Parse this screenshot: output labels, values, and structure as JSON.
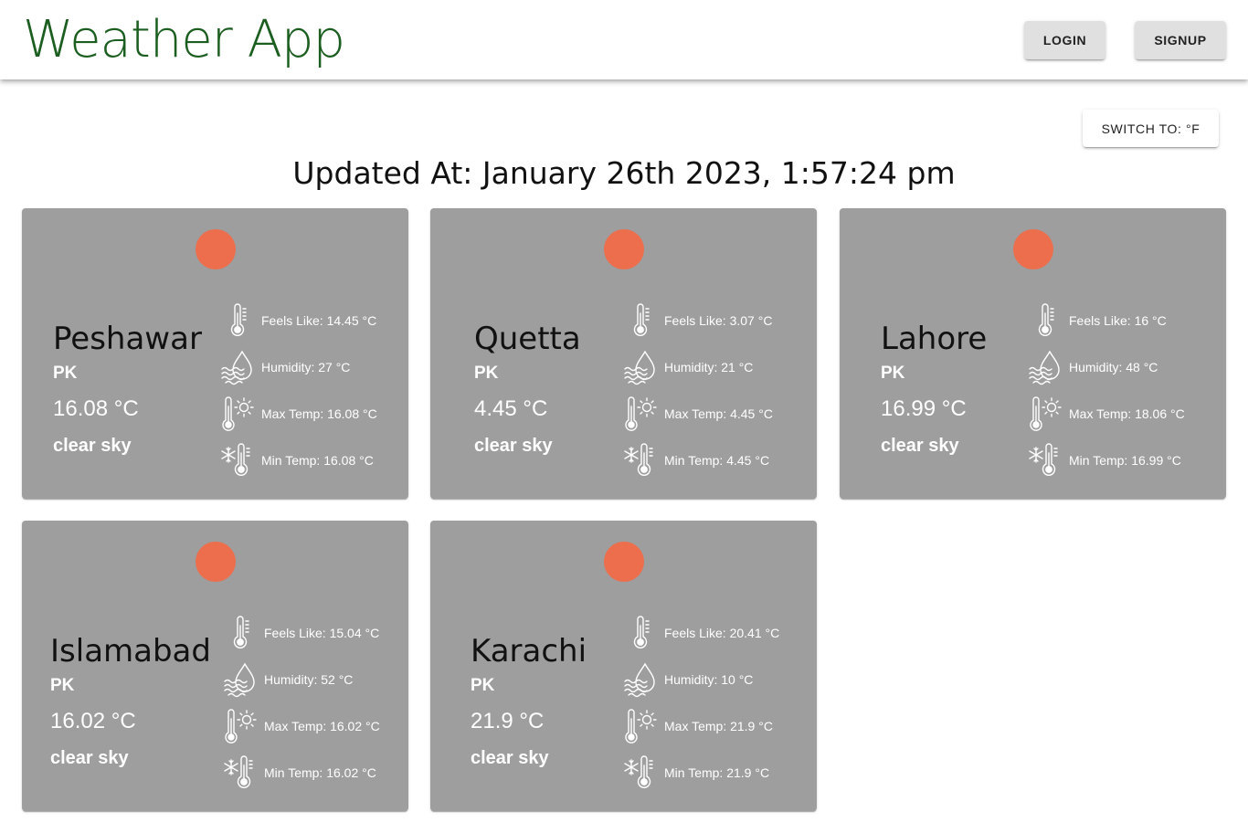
{
  "header": {
    "title": "Weather App",
    "login_label": "LOGIN",
    "signup_label": "SIGNUP"
  },
  "controls": {
    "switch_label": "SWITCH TO: °F"
  },
  "updated_at": "Updated At: January 26th 2023, 1:57:24 pm",
  "colors": {
    "title": "#1b5e20",
    "card": "#9e9e9e",
    "sun": "#ec6e4c"
  },
  "cards": [
    {
      "city": "Peshawar",
      "country": "PK",
      "temp": "16.08 °C",
      "description": "clear sky",
      "feels_like": "Feels Like: 14.45 °C",
      "humidity": "Humidity: 27 °C",
      "max_temp": "Max Temp: 16.08 °C",
      "min_temp": "Min Temp: 16.08 °C"
    },
    {
      "city": "Quetta",
      "country": "PK",
      "temp": "4.45 °C",
      "description": "clear sky",
      "feels_like": "Feels Like: 3.07 °C",
      "humidity": "Humidity: 21 °C",
      "max_temp": "Max Temp: 4.45 °C",
      "min_temp": "Min Temp: 4.45 °C"
    },
    {
      "city": "Lahore",
      "country": "PK",
      "temp": "16.99 °C",
      "description": "clear sky",
      "feels_like": "Feels Like: 16 °C",
      "humidity": "Humidity: 48 °C",
      "max_temp": "Max Temp: 18.06 °C",
      "min_temp": "Min Temp: 16.99 °C"
    },
    {
      "city": "Islamabad",
      "country": "PK",
      "temp": "16.02 °C",
      "description": "clear sky",
      "feels_like": "Feels Like: 15.04 °C",
      "humidity": "Humidity: 52 °C",
      "max_temp": "Max Temp: 16.02 °C",
      "min_temp": "Min Temp: 16.02 °C"
    },
    {
      "city": "Karachi",
      "country": "PK",
      "temp": "21.9 °C",
      "description": "clear sky",
      "feels_like": "Feels Like: 20.41 °C",
      "humidity": "Humidity: 10 °C",
      "max_temp": "Max Temp: 21.9 °C",
      "min_temp": "Min Temp: 21.9 °C"
    }
  ]
}
